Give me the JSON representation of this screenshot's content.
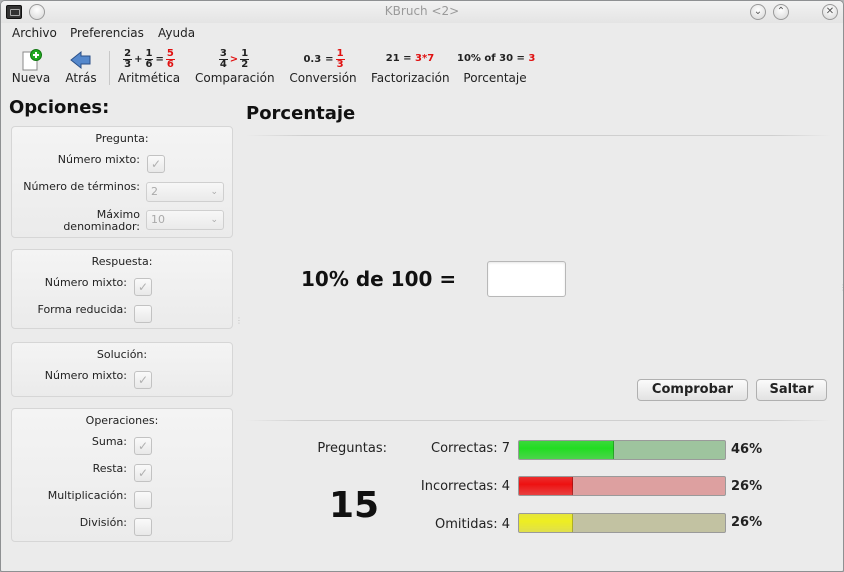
{
  "window": {
    "title": "KBruch <2>"
  },
  "menu": [
    "Archivo",
    "Preferencias",
    "Ayuda"
  ],
  "toolbar": {
    "nueva": "Nueva",
    "atras": "Atrás",
    "aritmetica": "Aritmética",
    "comparacion": "Comparación",
    "conversion": "Conversión",
    "factorizacion": "Factorización",
    "porcentaje": "Porcentaje",
    "aritmetica_icon": {
      "a_n": "2",
      "a_d": "3",
      "op": "+",
      "b_n": "1",
      "b_d": "6",
      "eq": "=",
      "r_n": "5",
      "r_d": "6"
    },
    "comparacion_icon": {
      "a_n": "3",
      "a_d": "4",
      "op": ">",
      "b_n": "1",
      "b_d": "2"
    },
    "conversion_icon": {
      "left": "0.3",
      "eq": "=",
      "r_n": "1",
      "r_d": "3"
    },
    "factorizacion_icon": {
      "left": "21 =",
      "right": "3*7"
    },
    "porcentaje_icon": {
      "left": "10% of 30 =",
      "right": "3"
    }
  },
  "options": {
    "title": "Opciones:",
    "pregunta": {
      "title": "Pregunta:",
      "numero_mixto": "Número mixto:",
      "num_terminos": "Número de términos:",
      "num_terminos_value": "2",
      "max_denom_1": "Máximo",
      "max_denom_2": "denominador:",
      "max_denom_value": "10"
    },
    "respuesta": {
      "title": "Respuesta:",
      "numero_mixto": "Número mixto:",
      "forma_reducida": "Forma reducida:"
    },
    "solucion": {
      "title": "Solución:",
      "numero_mixto": "Número mixto:"
    },
    "operaciones": {
      "title": "Operaciones:",
      "suma": "Suma:",
      "resta": "Resta:",
      "multiplicacion": "Multiplicación:",
      "division": "División:"
    }
  },
  "main": {
    "title": "Porcentaje",
    "question": "10% de 100 =",
    "answer_value": "",
    "comprobar": "Comprobar",
    "saltar": "Saltar"
  },
  "stats": {
    "preguntas_label": "Preguntas:",
    "preguntas_count": "15",
    "correctas": {
      "label": "Correctas: 7",
      "percent": "46%",
      "fraction": 0.46
    },
    "incorrectas": {
      "label": "Incorrectas: 4",
      "percent": "26%",
      "fraction": 0.26
    },
    "omitidas": {
      "label": "Omitidas: 4",
      "percent": "26%",
      "fraction": 0.26
    }
  },
  "colors": {
    "correct": "#22dd22",
    "incorrect": "#ee1111",
    "skipped": "#eeee22"
  }
}
